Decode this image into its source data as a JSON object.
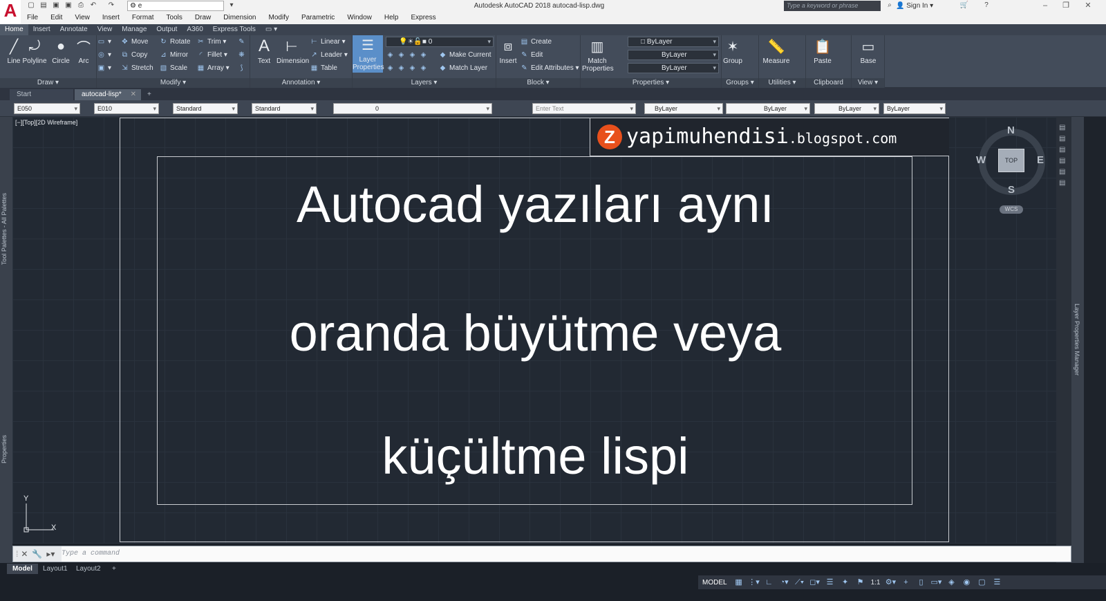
{
  "app": {
    "title": "Autodesk AutoCAD 2018    autocad-lisp.dwg",
    "workspace": "e",
    "search_placeholder": "Type a keyword or phrase",
    "sign_in": "Sign In",
    "logo_letter": "A"
  },
  "menu": [
    "File",
    "Edit",
    "View",
    "Insert",
    "Format",
    "Tools",
    "Draw",
    "Dimension",
    "Modify",
    "Parametric",
    "Window",
    "Help",
    "Express"
  ],
  "ribbon_tabs": [
    "Home",
    "Insert",
    "Annotate",
    "View",
    "Manage",
    "Output",
    "A360",
    "Express Tools"
  ],
  "ribbon": {
    "draw": {
      "title": "Draw ▾",
      "line": "Line",
      "polyline": "Polyline",
      "circle": "Circle",
      "arc": "Arc"
    },
    "modify": {
      "title": "Modify ▾",
      "move": "Move",
      "rotate": "Rotate",
      "trim": "Trim ▾",
      "copy": "Copy",
      "mirror": "Mirror",
      "fillet": "Fillet ▾",
      "stretch": "Stretch",
      "scale": "Scale",
      "array": "Array ▾"
    },
    "annotation": {
      "title": "Annotation ▾",
      "text": "Text",
      "dimension": "Dimension",
      "linear": "Linear ▾",
      "leader": "Leader ▾",
      "table": "Table"
    },
    "layers": {
      "title": "Layers ▾",
      "layer_properties": "Layer Properties",
      "layer_current": "0",
      "make_current": "Make Current",
      "match_layer": "Match Layer"
    },
    "block": {
      "title": "Block ▾",
      "insert": "Insert",
      "create": "Create",
      "edit": "Edit",
      "edit_attributes": "Edit Attributes ▾"
    },
    "properties": {
      "title": "Properties ▾",
      "match": "Match Properties",
      "color": "ByLayer",
      "linetype": "ByLayer",
      "lineweight": "ByLayer"
    },
    "groups": {
      "title": "Groups ▾",
      "group": "Group"
    },
    "utilities": {
      "title": "Utilities ▾",
      "measure": "Measure"
    },
    "clipboard": {
      "title": "Clipboard",
      "paste": "Paste"
    },
    "view": {
      "title": "View ▾",
      "base": "Base"
    }
  },
  "doc_tabs": [
    "Start",
    "autocad-lisp*"
  ],
  "props_toolbar": {
    "text_style": "E050",
    "dim_style": "E010",
    "table_style": "Standard",
    "mleader_style": "Standard",
    "layer": "0",
    "enter_text": "Enter Text",
    "color": "ByLayer",
    "linetype": "ByLayer",
    "lineweight": "ByLayer",
    "plotstyle": "ByLayer"
  },
  "palettes": {
    "left_top": "Tool Palettes - All Palettes",
    "left_bottom": "Properties",
    "right": "Layer Properties Manager"
  },
  "viewport": {
    "label": "[−][Top][2D Wireframe]"
  },
  "drawing": {
    "line1": "Autocad yazıları aynı",
    "line2": "oranda büyütme veya",
    "line3": "küçültme lispi",
    "banner_letter": "Z",
    "banner_name": "yapimuhendisi",
    "banner_domain": ".blogspot.com"
  },
  "viewcube": {
    "n": "N",
    "s": "S",
    "e": "E",
    "w": "W",
    "face": "TOP",
    "wcs": "WCS"
  },
  "ucs": {
    "x": "X",
    "y": "Y"
  },
  "command": {
    "placeholder": "Type a command"
  },
  "layout_tabs": [
    "Model",
    "Layout1",
    "Layout2"
  ],
  "status": {
    "model": "MODEL",
    "scale": "1:1"
  }
}
